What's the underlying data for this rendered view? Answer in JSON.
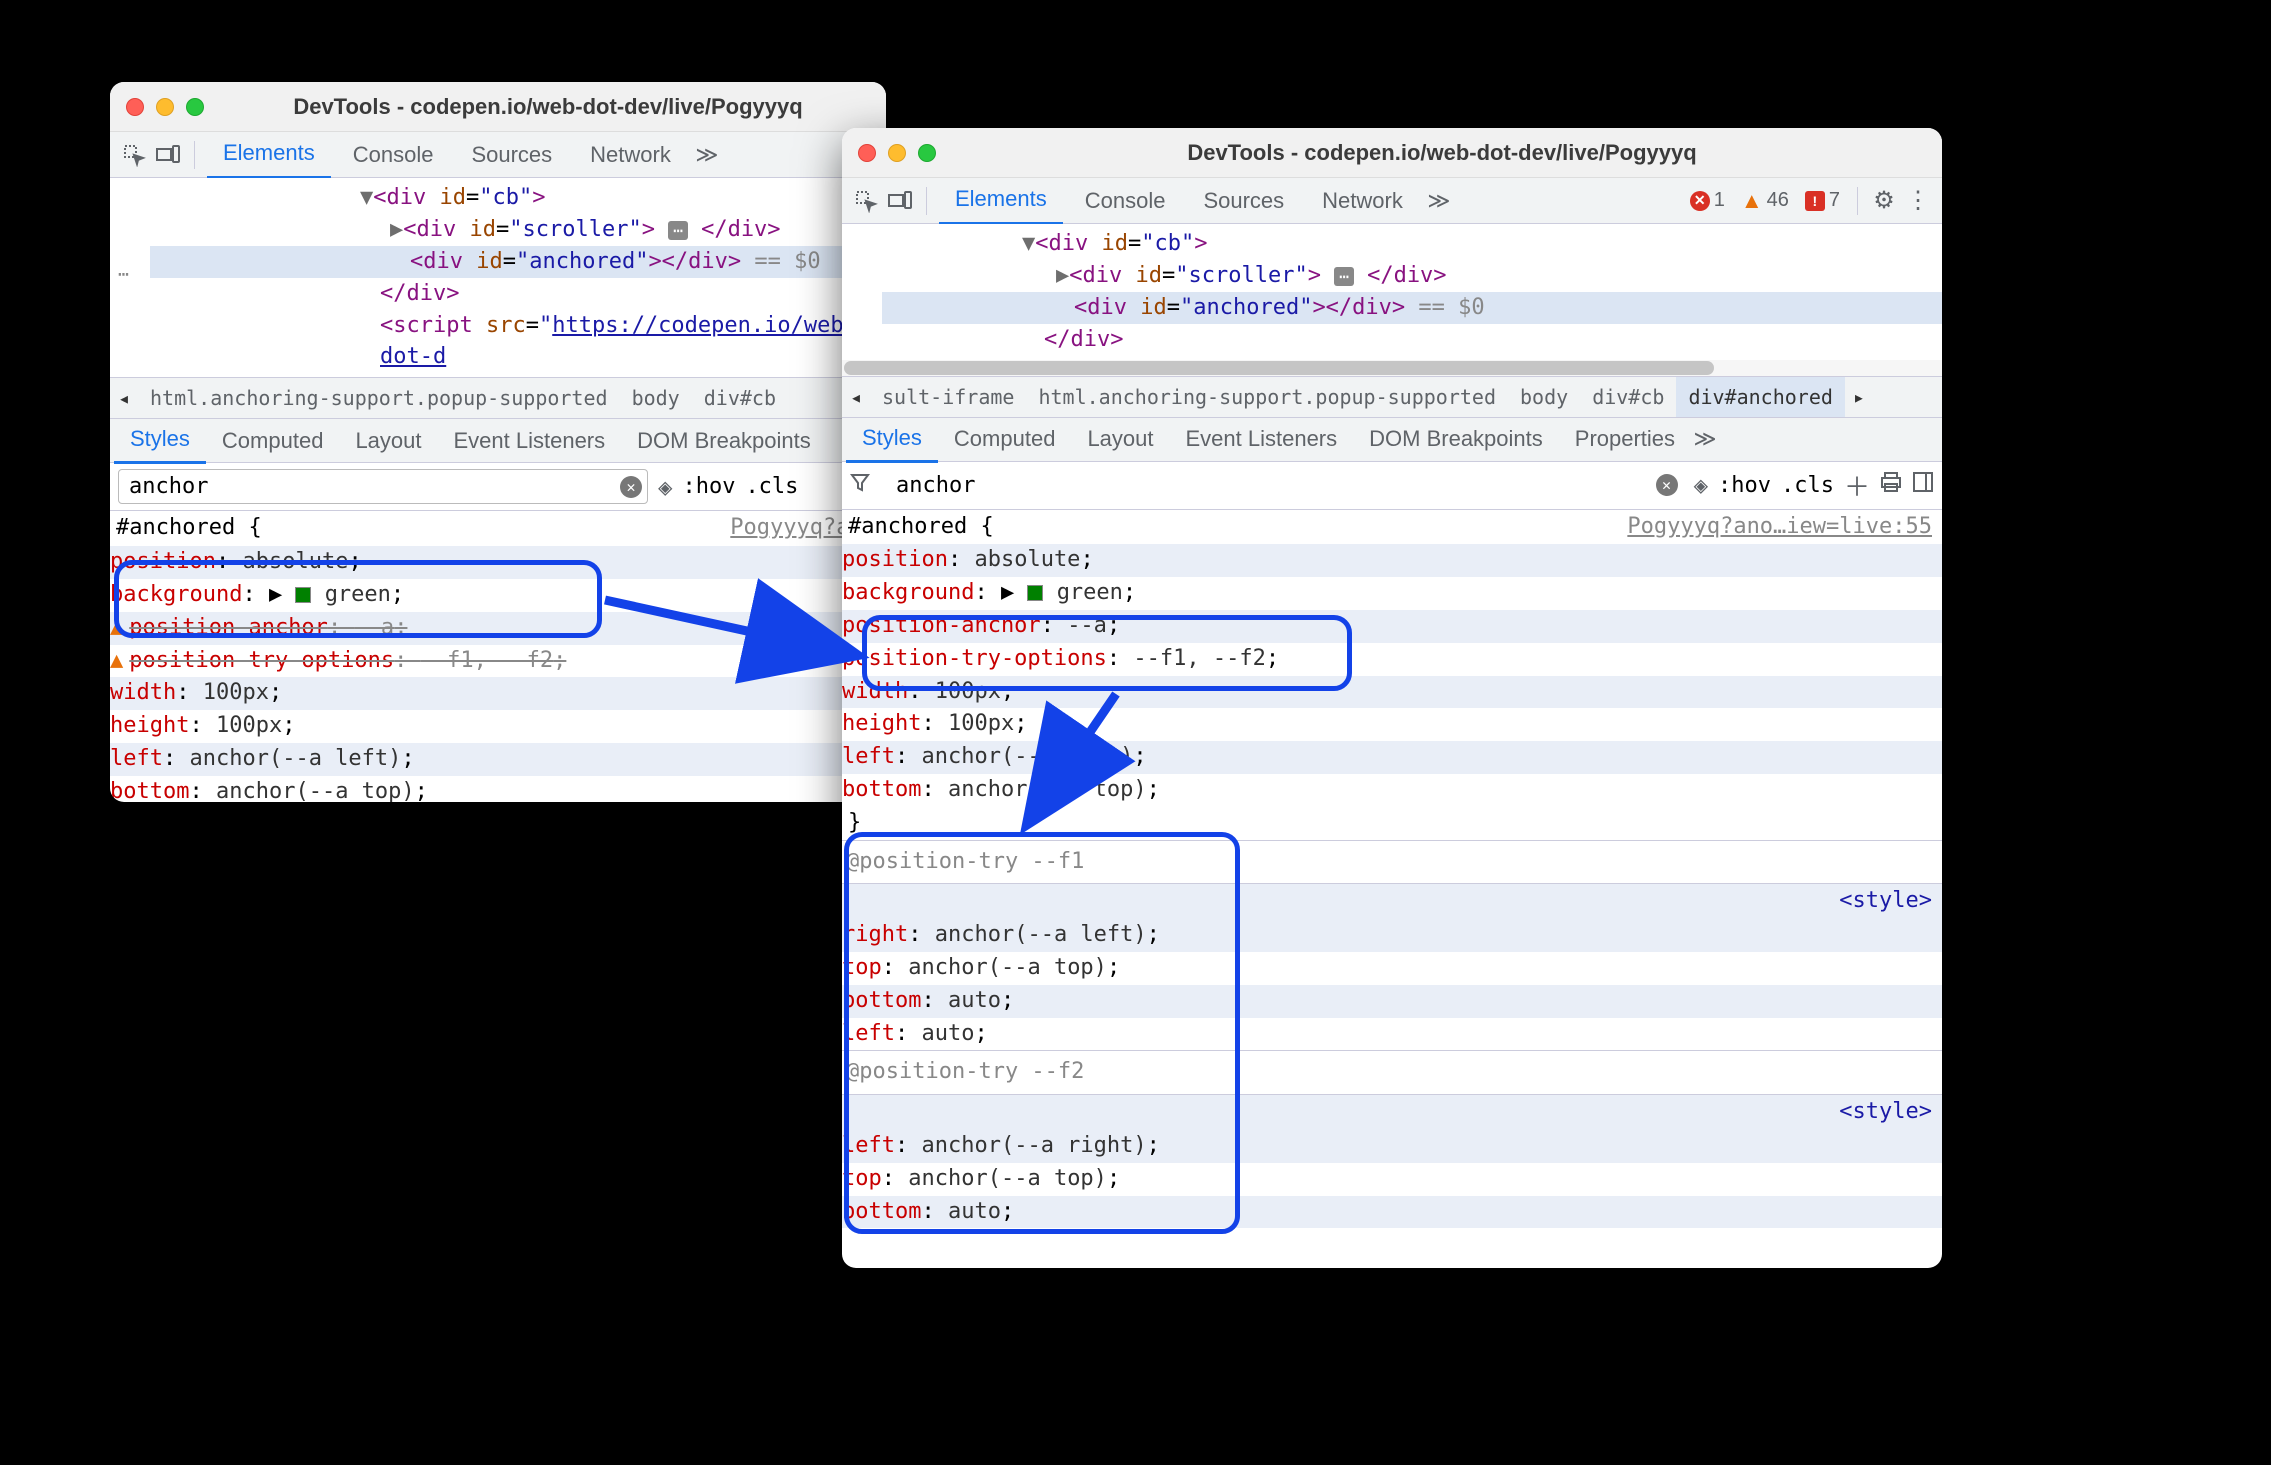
{
  "windowTitle": "DevTools - codepen.io/web-dot-dev/live/Pogyyyq",
  "mainTabs": [
    "Elements",
    "Console",
    "Sources",
    "Network"
  ],
  "styleTabsLeft": [
    "Styles",
    "Computed",
    "Layout",
    "Event Listeners",
    "DOM Breakpoints"
  ],
  "styleTabsRight": [
    "Styles",
    "Computed",
    "Layout",
    "Event Listeners",
    "DOM Breakpoints",
    "Properties"
  ],
  "filterValue": "anchor",
  "hov": ":hov",
  "cls": ".cls",
  "errors": {
    "x": "1",
    "tri": "46",
    "sq": "7"
  },
  "leftDom": {
    "line1_pre": "▼<div id=\"cb\">",
    "line2_pre": "  ▶<div id=\"scroller\">",
    "line2_badge": "⋯",
    "line2_post": "</div>",
    "line3_a": "    <div id=\"anchored\"></div>",
    "line3_eq": " == $0",
    "line4": "</div>",
    "line5_a": "<script src=\"",
    "line5_url": "https://codepen.io/web-dot-d"
  },
  "leftCrumbs": [
    "html.anchoring-support.popup-supported",
    "body",
    "div#cb"
  ],
  "leftSrcLink": "Pogyyyq?an…",
  "leftCss": {
    "selector": "#anchored {",
    "d1": "position",
    "d1v": "absolute",
    "d2": "background",
    "d2v": "green",
    "d3": "position-anchor",
    "d3v": "--a",
    "d4": "position-try-options",
    "d4v": "--f1, --f2",
    "d5": "width",
    "d5v": "100px",
    "d6": "height",
    "d6v": "100px",
    "d7": "left",
    "d7v": "anchor(--a left)",
    "d8": "bottom",
    "d8v": "anchor(--a top)"
  },
  "rightDom": {
    "line1": "▼<div id=\"cb\">",
    "line2a": "  ▶<div id=\"scroller\">",
    "line2badge": "⋯",
    "line2b": "</div>",
    "line3": "    <div id=\"anchored\"></div>",
    "line3eq": " == $0",
    "line4": "  </div>"
  },
  "rightCrumbs_pre": "sult-iframe",
  "rightCrumbs": [
    "html.anchoring-support.popup-supported",
    "body",
    "div#cb",
    "div#anchored"
  ],
  "rightSrcLink": "Pogyyyq?ano…iew=live:55",
  "rightCss": {
    "selector": "#anchored {",
    "d1": "position",
    "d1v": "absolute",
    "d2": "background",
    "d2v": "green",
    "d3": "position-anchor",
    "d3v": "--a",
    "d4": "position-try-options",
    "d4v": "--f1, --f2",
    "d5": "width",
    "d5v": "100px",
    "d6": "height",
    "d6v": "100px",
    "d7": "left",
    "d7v": "anchor(--a left)",
    "d8": "bottom",
    "d8v": "anchor(--a top)"
  },
  "pt1": {
    "header": "@position-try --f1",
    "styleLink": "<style>",
    "d1": "right",
    "d1v": "anchor(--a left)",
    "d2": "top",
    "d2v": "anchor(--a top)",
    "d3": "bottom",
    "d3v": "auto",
    "d4": "left",
    "d4v": "auto"
  },
  "pt2": {
    "header": "@position-try --f2",
    "styleLink": "<style>",
    "d1": "left",
    "d1v": "anchor(--a right)",
    "d2": "top",
    "d2v": "anchor(--a top)",
    "d3": "bottom",
    "d3v": "auto"
  }
}
